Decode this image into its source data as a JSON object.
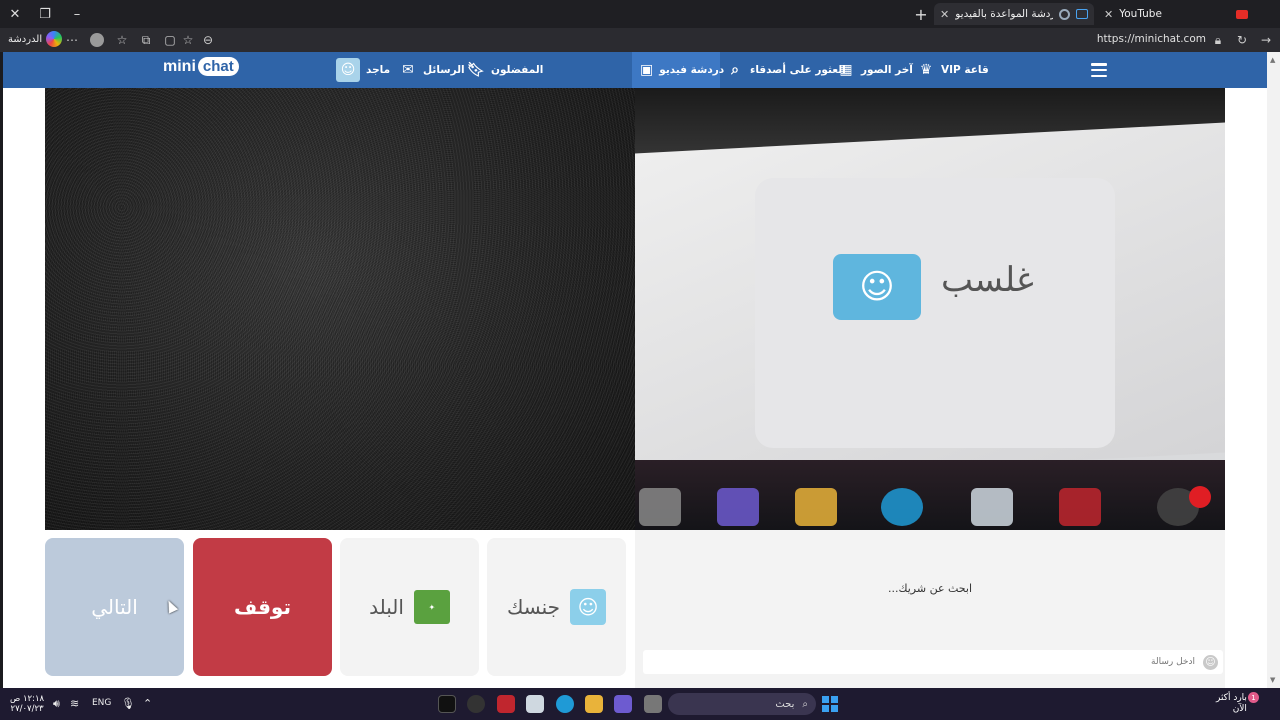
{
  "browser": {
    "tabs": [
      {
        "label": "YouTube",
        "active": false
      },
      {
        "label": "غرف دردشة المواعدة بالفيديو ...",
        "active": true
      }
    ],
    "new_tab": "+",
    "minimize": "–",
    "restore": "❐",
    "close": "✕",
    "address": "https://minichat.com",
    "profile_label": "الدردشة",
    "more": "⋯"
  },
  "site": {
    "logo_mini": "mini",
    "logo_chat": "chat",
    "nav": {
      "vip": "VIP قاعة",
      "latest_photos": "آخر الصور",
      "find_friends": "العثور على أصدقاء",
      "video_chat": "دردشة فيديو",
      "favorites": "المفضلون",
      "messages": "الرسائل",
      "user": "ماجد"
    }
  },
  "remote_video": {
    "word": "ﻏﻠﺴﺐ"
  },
  "controls": {
    "next": "التالي",
    "stop": "توقف",
    "country": "البلد",
    "gender": "جنسك"
  },
  "chat": {
    "status": "...ابحث عن شريك",
    "input_placeholder": "أدخل رسالة"
  },
  "taskbar": {
    "time": "١٢:١٨ ص",
    "date": "٢٧/٠٧/٢٣",
    "lang": "ENG",
    "search": "بحث",
    "weather_line1": "بارد أكثر",
    "weather_line2": "الآن",
    "notification_count": "1"
  },
  "colors": {
    "nav_bg": "#2f64a8",
    "stop_bg": "#c23b45",
    "next_bg": "#bccadb"
  }
}
